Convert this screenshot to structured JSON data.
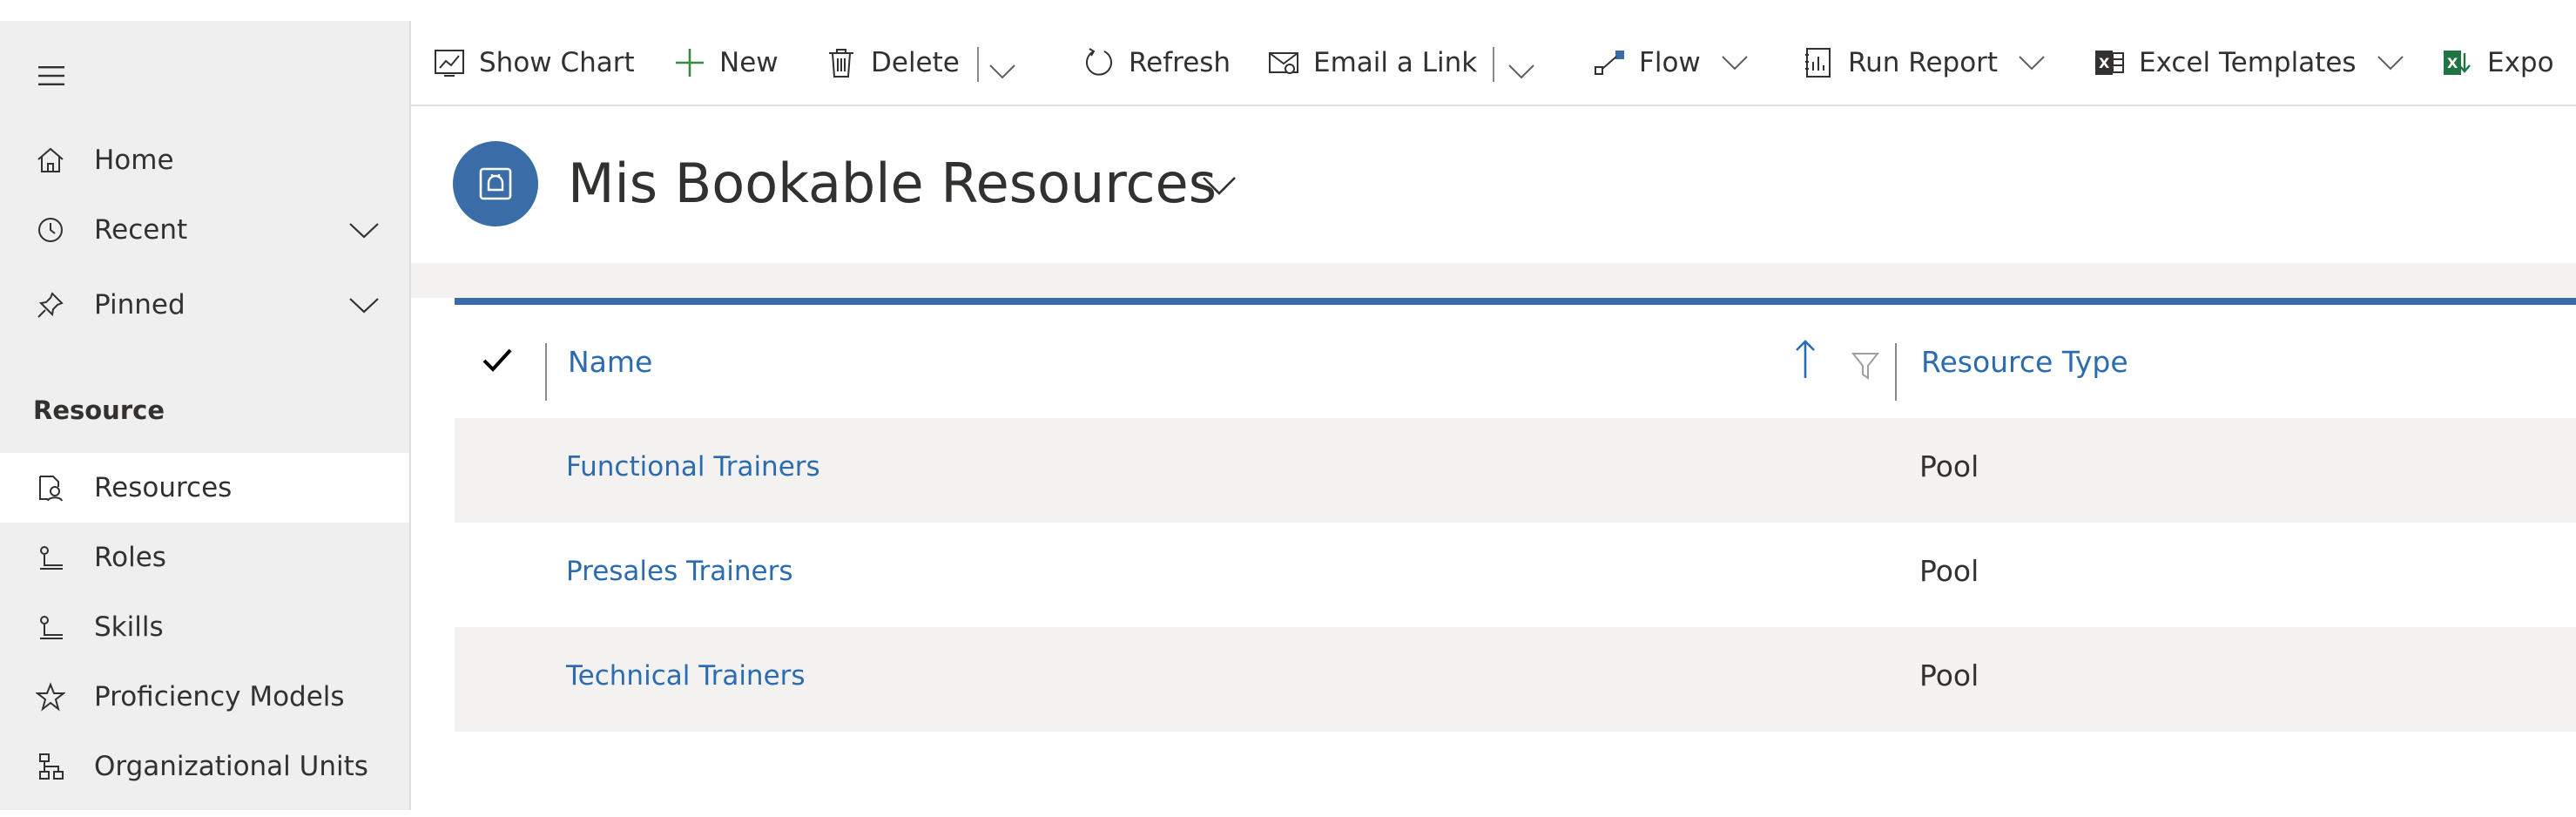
{
  "sidebar": {
    "menu_icon": "hamburger-menu-icon",
    "items": [
      {
        "label": "Home",
        "icon": "home-icon"
      },
      {
        "label": "Recent",
        "icon": "clock-icon"
      },
      {
        "label": "Pinned",
        "icon": "pin-icon"
      }
    ],
    "section_title": "Resource",
    "section_items": [
      {
        "label": "Resources",
        "icon": "resource-icon",
        "selected": true
      },
      {
        "label": "Roles",
        "icon": "role-icon"
      },
      {
        "label": "Skills",
        "icon": "skill-icon"
      },
      {
        "label": "Proficiency Models",
        "icon": "star-icon"
      },
      {
        "label": "Organizational Units",
        "icon": "org-chart-icon"
      }
    ]
  },
  "command_bar": {
    "show_chart": "Show Chart",
    "new": "New",
    "delete": "Delete",
    "refresh": "Refresh",
    "email_link": "Email a Link",
    "flow": "Flow",
    "run_report": "Run Report",
    "excel_templates": "Excel Templates",
    "export": "Expo"
  },
  "view": {
    "title": "Mis Bookable Resources",
    "columns": {
      "name": "Name",
      "resource_type": "Resource Type"
    },
    "rows": [
      {
        "name": "Functional Trainers",
        "resource_type": "Pool"
      },
      {
        "name": "Presales Trainers",
        "resource_type": "Pool"
      },
      {
        "name": "Technical Trainers",
        "resource_type": "Pool"
      }
    ],
    "sort": "ascending"
  },
  "colors": {
    "accent": "#3a6da8",
    "link": "#2b6cb0",
    "sidebar_bg": "#efefef",
    "row_alt": "#f3f2f1",
    "excel_green": "#217346"
  }
}
